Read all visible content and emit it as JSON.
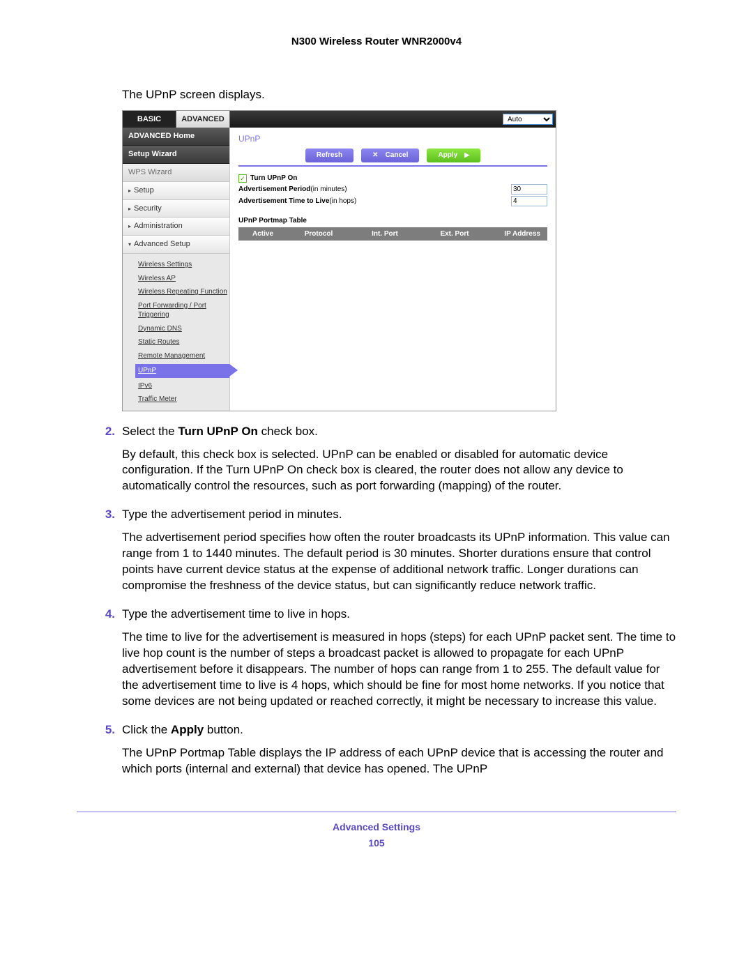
{
  "doc_header": "N300 Wireless Router WNR2000v4",
  "lead_text": "The UPnP screen displays.",
  "router": {
    "tab_basic": "BASIC",
    "tab_advanced": "ADVANCED",
    "auto_select": "Auto",
    "side_adv_home": "ADVANCED Home",
    "side_setup_wizard": "Setup Wizard",
    "side_wps_wizard": "WPS Wizard",
    "side_setup": "Setup",
    "side_security": "Security",
    "side_admin": "Administration",
    "side_adv_setup": "Advanced Setup",
    "submenu": {
      "wireless_settings": "Wireless Settings",
      "wireless_ap": "Wireless AP",
      "wireless_repeating": "Wireless Repeating Function",
      "port_forwarding": "Port Forwarding / Port Triggering",
      "dynamic_dns": "Dynamic DNS",
      "static_routes": "Static Routes",
      "remote_mgmt": "Remote Management",
      "upnp": "UPnP",
      "ipv6": "IPv6",
      "traffic_meter": "Traffic Meter"
    },
    "content_title": "UPnP",
    "btn_refresh": "Refresh",
    "btn_cancel": "Cancel",
    "btn_apply": "Apply",
    "turn_upnp_on": "Turn UPnP On",
    "adv_period_label": "Advertisement Period",
    "adv_period_unit": "(in minutes)",
    "adv_period_value": "30",
    "adv_ttl_label": "Advertisement Time to Live",
    "adv_ttl_unit": "(in hops)",
    "adv_ttl_value": "4",
    "portmap_title": "UPnP Portmap Table",
    "cols": {
      "active": "Active",
      "protocol": "Protocol",
      "int_port": "Int. Port",
      "ext_port": "Ext. Port",
      "ip_address": "IP Address"
    }
  },
  "steps": {
    "s2_num": "2.",
    "s2_line1_a": "Select the ",
    "s2_line1_b": "Turn UPnP On",
    "s2_line1_c": " check box.",
    "s2_para": "By default, this check box is selected. UPnP can be enabled or disabled for automatic device configuration. If the Turn UPnP On check box is cleared, the router does not allow any device to automatically control the resources, such as port forwarding (mapping) of the router.",
    "s3_num": "3.",
    "s3_line1": "Type the advertisement period in minutes.",
    "s3_para": "The advertisement period specifies how often the router broadcasts its UPnP information. This value can range from 1 to 1440 minutes. The default period is 30 minutes. Shorter durations ensure that control points have current device status at the expense of additional network traffic. Longer durations can compromise the freshness of the device status, but can significantly reduce network traffic.",
    "s4_num": "4.",
    "s4_line1": "Type the advertisement time to live in hops.",
    "s4_para": "The time to live for the advertisement is measured in hops (steps) for each UPnP packet sent. The time to live hop count is the number of steps a broadcast packet is allowed to propagate for each UPnP advertisement before it disappears. The number of hops can range from 1 to 255. The default value for the advertisement time to live is 4 hops, which should be fine for most home networks. If you notice that some devices are not being updated or reached correctly, it might be necessary to increase this value.",
    "s5_num": "5.",
    "s5_line1_a": "Click the ",
    "s5_line1_b": "Apply",
    "s5_line1_c": " button.",
    "s5_para": "The UPnP Portmap Table displays the IP address of each UPnP device that is accessing the router and which ports (internal and external) that device has opened. The UPnP"
  },
  "footer": {
    "title": "Advanced Settings",
    "page": "105"
  }
}
